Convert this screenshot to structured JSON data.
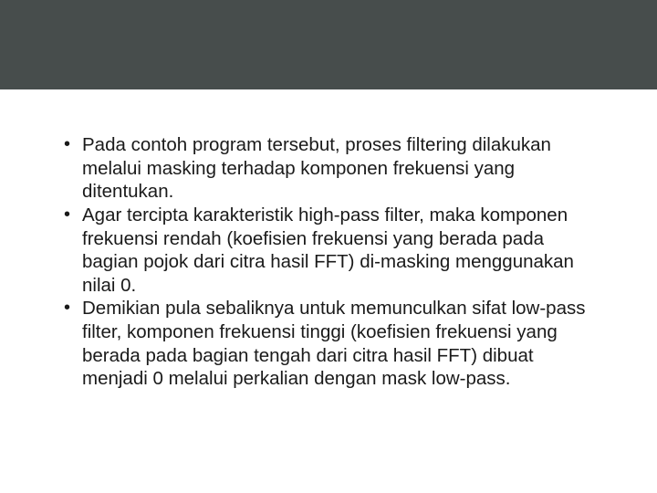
{
  "slide": {
    "bullets": [
      "Pada contoh program tersebut,  proses filtering dilakukan melalui  masking terhadap komponen frekuensi yang ditentukan.",
      "Agar  tercipta karakteristik high-pass filter, maka komponen frekuensi rendah (koefisien frekuensi yang berada pada bagian pojok dari citra hasil FFT) di-masking menggunakan nilai 0.",
      "Demikian pula sebaliknya untuk memunculkan sifat low-pass filter, komponen frekuensi tinggi (koefisien frekuensi yang berada pada bagian tengah dari citra hasil FFT) dibuat menjadi 0 melalui perkalian dengan mask low-pass."
    ]
  }
}
